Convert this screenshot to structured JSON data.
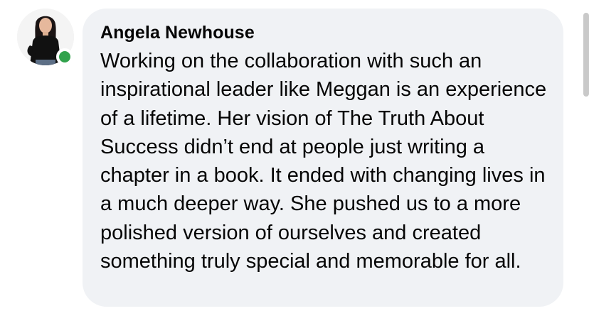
{
  "comment": {
    "author": "Angela Newhouse",
    "author_online": true,
    "text": "Working on the collaboration with such an inspirational leader like Meggan is an experience of a lifetime. Her vision of The Truth About Success didn’t end at people just writing a chapter in a book. It ended with changing lives in a much deeper way. She pushed us to a more polished version of ourselves and created something truly special and memorable for all."
  },
  "colors": {
    "bubble_background": "#f0f2f5",
    "text": "#050505",
    "online_indicator": "#31a24c"
  },
  "icons": {
    "presence": "online-status-dot-icon"
  }
}
